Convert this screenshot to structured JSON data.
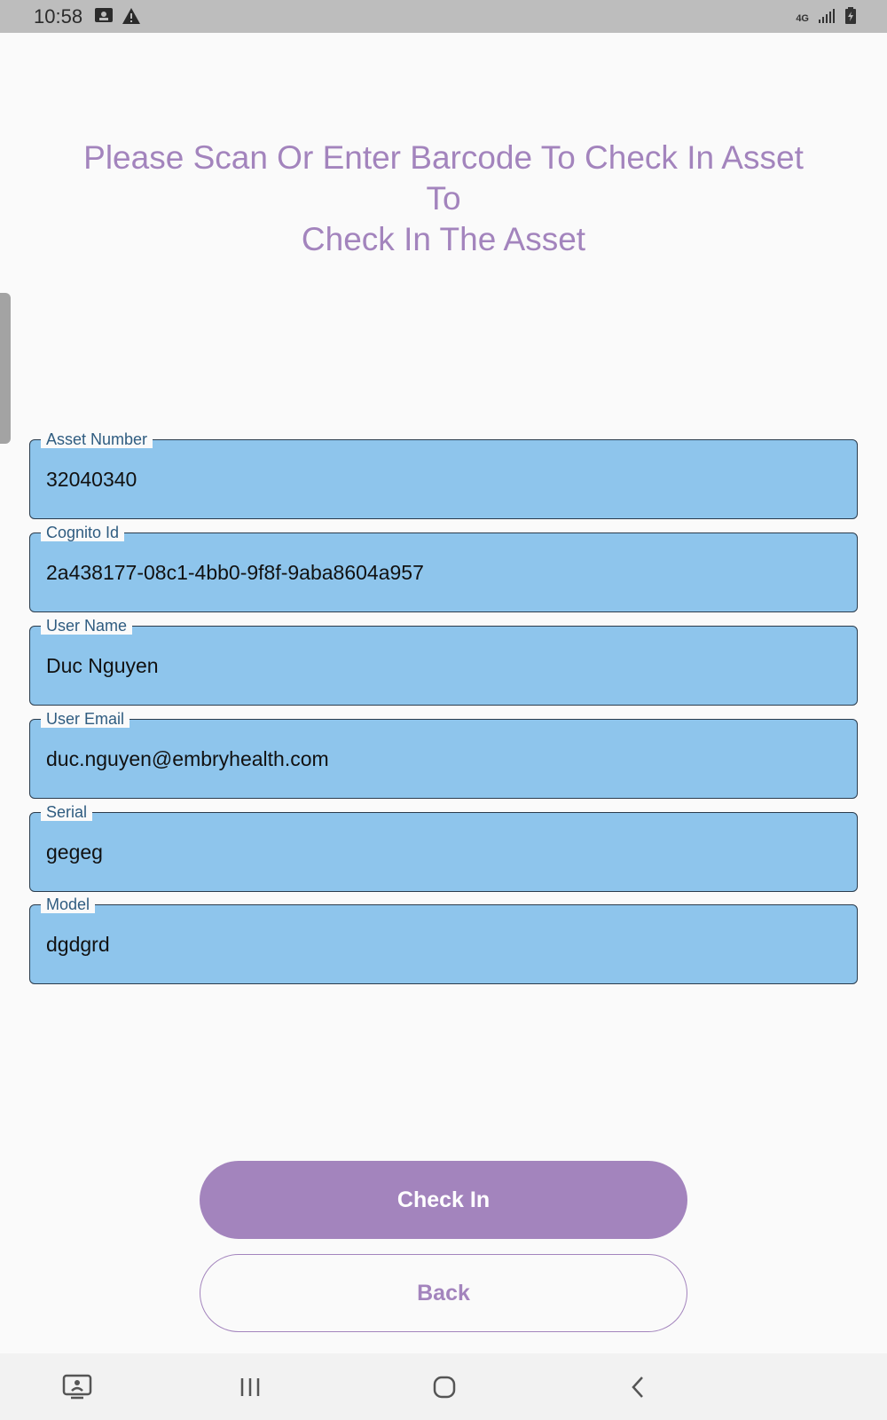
{
  "status_bar": {
    "time": "10:58",
    "network_label": "4G",
    "icons": [
      "screenshot-icon",
      "warning-icon",
      "network-4g-icon",
      "signal-icon",
      "battery-charging-icon"
    ]
  },
  "heading": {
    "line1": "Please Scan Or Enter Barcode To Check In Asset",
    "line2": "To",
    "line3": "Check In The Asset"
  },
  "fields": {
    "asset_number": {
      "label": "Asset Number",
      "value": "32040340"
    },
    "cognito_id": {
      "label": "Cognito Id",
      "value": "2a438177-08c1-4bb0-9f8f-9aba8604a957"
    },
    "user_name": {
      "label": "User Name",
      "value": "Duc Nguyen"
    },
    "user_email": {
      "label": "User Email",
      "value": "duc.nguyen@embryhealth.com"
    },
    "serial": {
      "label": "Serial",
      "value": "gegeg"
    },
    "model": {
      "label": "Model",
      "value": "dgdgrd"
    }
  },
  "buttons": {
    "check_in": "Check In",
    "back": "Back"
  },
  "nav_bar": {
    "icons": [
      "recent-screen-icon",
      "recents-icon",
      "home-icon",
      "back-icon"
    ]
  },
  "colors": {
    "accent": "#a384bd",
    "field_bg": "#8ec5ec",
    "field_border": "#2a3b4c",
    "field_label": "#2f5c80",
    "page_bg": "#fafafa",
    "status_bar_bg": "#bdbdbd",
    "nav_bar_bg": "#f2f2f2"
  }
}
